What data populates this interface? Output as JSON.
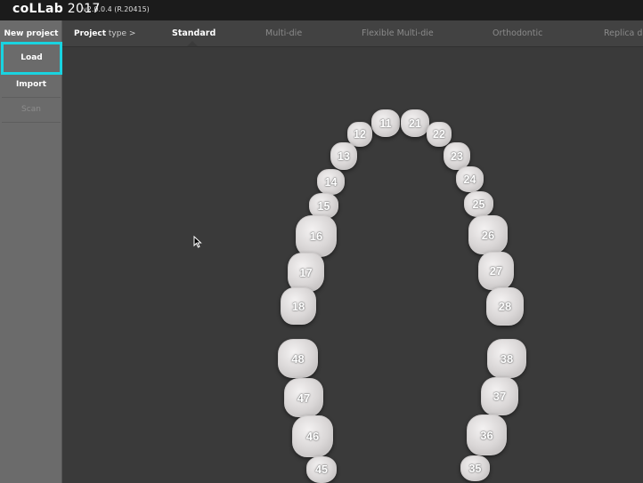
{
  "app": {
    "brand_main": "coLLab",
    "brand_year": "2017",
    "version": "v2.0.0.4 (R.20415)"
  },
  "sidebar": {
    "items": [
      {
        "label": "New project",
        "state": "normal"
      },
      {
        "label": "Load",
        "state": "active"
      },
      {
        "label": "Import",
        "state": "normal"
      },
      {
        "label": "Scan",
        "state": "disabled"
      }
    ],
    "highlight_color": "#19d3e0"
  },
  "tabbar": {
    "project_type_bold": "Project",
    "project_type_rest": " type >",
    "tabs": [
      {
        "label": "Standard",
        "selected": true
      },
      {
        "label": "Multi-die",
        "selected": false
      },
      {
        "label": "Flexible Multi-die",
        "selected": false
      },
      {
        "label": "Orthodontic",
        "selected": false
      },
      {
        "label": "Replica de",
        "selected": false
      }
    ]
  },
  "teeth": {
    "upper_right": [
      "11",
      "12",
      "13",
      "14",
      "15",
      "16",
      "17",
      "18"
    ],
    "upper_left": [
      "21",
      "22",
      "23",
      "24",
      "25",
      "26",
      "27",
      "28"
    ],
    "lower_left": [
      "38",
      "37",
      "36",
      "35"
    ],
    "lower_right": [
      "48",
      "47",
      "46",
      "45"
    ]
  }
}
